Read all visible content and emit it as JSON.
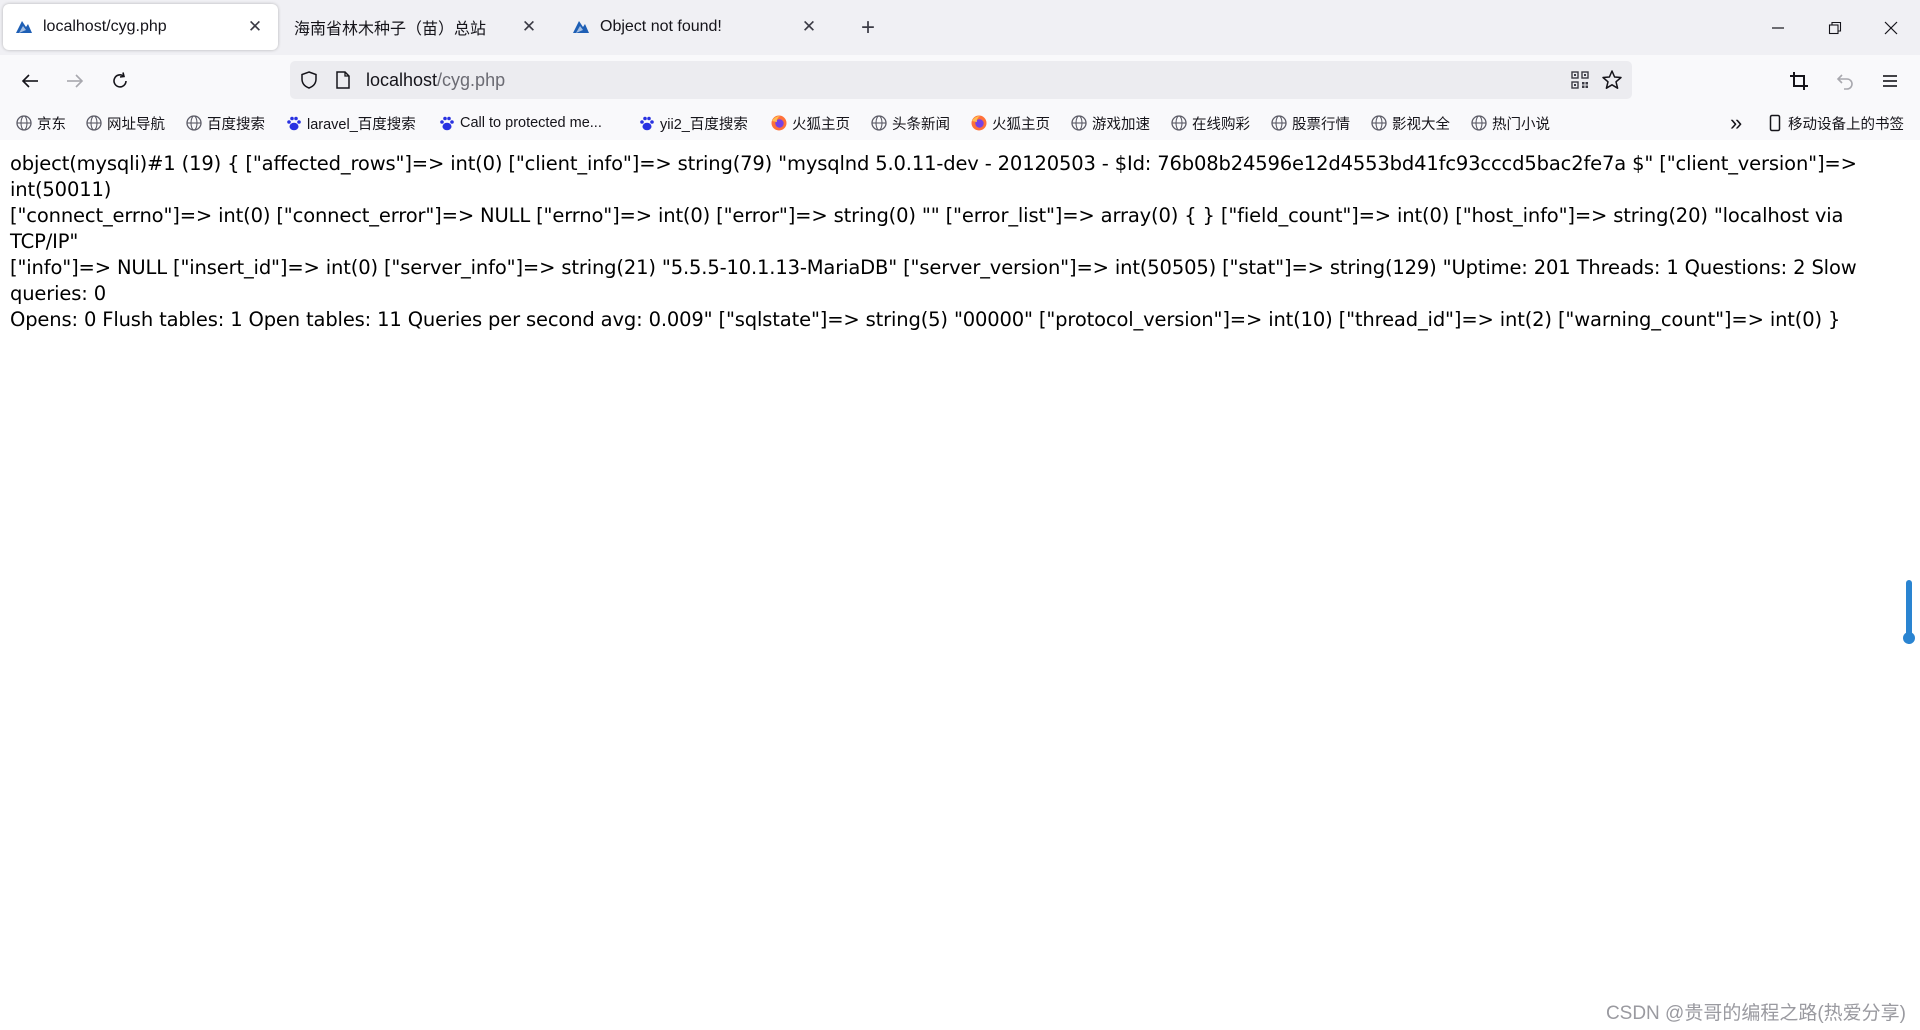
{
  "tabs": [
    {
      "title": "localhost/cyg.php",
      "active": true,
      "close_glyph": "✕"
    },
    {
      "title": "海南省林木种子（苗）总站",
      "active": false,
      "close_glyph": "✕"
    },
    {
      "title": "Object not found!",
      "active": false,
      "close_glyph": "✕"
    }
  ],
  "new_tab_glyph": "+",
  "window_controls": {
    "minimize": "minimize-icon",
    "restore": "restore-icon",
    "close": "close-icon"
  },
  "nav": {
    "url_host": "localhost",
    "url_path": "/cyg.php"
  },
  "bookmarks": [
    {
      "label": "京东",
      "icon": "globe-icon"
    },
    {
      "label": "网址导航",
      "icon": "globe-icon"
    },
    {
      "label": "百度搜索",
      "icon": "globe-icon"
    },
    {
      "label": "laravel_百度搜索",
      "icon": "baidu-paw-icon"
    },
    {
      "label": "Call to protected me...",
      "icon": "baidu-paw-icon"
    },
    {
      "label": "yii2_百度搜索",
      "icon": "baidu-paw-icon"
    },
    {
      "label": "火狐主页",
      "icon": "firefox-icon"
    },
    {
      "label": "头条新闻",
      "icon": "globe-icon"
    },
    {
      "label": "火狐主页",
      "icon": "firefox-icon"
    },
    {
      "label": "游戏加速",
      "icon": "globe-icon"
    },
    {
      "label": "在线购彩",
      "icon": "globe-icon"
    },
    {
      "label": "股票行情",
      "icon": "globe-icon"
    },
    {
      "label": "影视大全",
      "icon": "globe-icon"
    },
    {
      "label": "热门小说",
      "icon": "globe-icon"
    }
  ],
  "bookmarks_overflow": "»",
  "mobile_bookmarks": "移动设备上的书签",
  "page": {
    "lines": [
      "object(mysqli)#1 (19) { [\"affected_rows\"]=> int(0) [\"client_info\"]=> string(79) \"mysqlnd 5.0.11-dev - 20120503 - $Id: 76b08b24596e12d4553bd41fc93cccd5bac2fe7a $\" [\"client_version\"]=> int(50011)",
      "[\"connect_errno\"]=> int(0) [\"connect_error\"]=> NULL [\"errno\"]=> int(0) [\"error\"]=> string(0) \"\" [\"error_list\"]=> array(0) { } [\"field_count\"]=> int(0) [\"host_info\"]=> string(20) \"localhost via TCP/IP\"",
      "[\"info\"]=> NULL [\"insert_id\"]=> int(0) [\"server_info\"]=> string(21) \"5.5.5-10.1.13-MariaDB\" [\"server_version\"]=> int(50505) [\"stat\"]=> string(129) \"Uptime: 201 Threads: 1 Questions: 2 Slow queries: 0",
      "Opens: 0 Flush tables: 1 Open tables: 11 Queries per second avg: 0.009\" [\"sqlstate\"]=> string(5) \"00000\" [\"protocol_version\"]=> int(10) [\"thread_id\"]=> int(2) [\"warning_count\"]=> int(0) }"
    ]
  },
  "watermark": "CSDN @贵哥的编程之路(热爱分享)",
  "colors": {
    "accent": "#2a84d1",
    "tabstrip": "#f0f0f4",
    "toolbar": "#f9f9fb",
    "urlbar": "#ececf0"
  }
}
